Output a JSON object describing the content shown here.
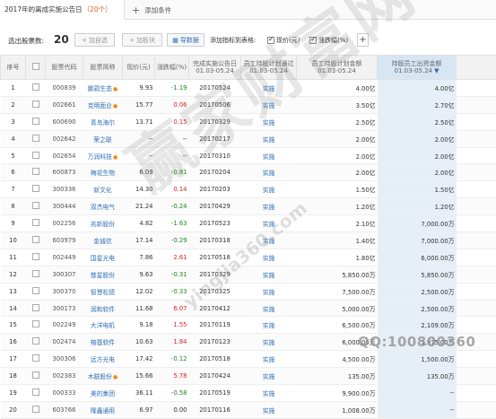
{
  "tab": {
    "title": "2017年的离成实施公告日",
    "count": "（20个）",
    "add_label": "添加条件"
  },
  "toolbar": {
    "selected_label": "选出股票数:",
    "selected_count": "20",
    "add_self_label": "加自选",
    "add_block_label": "加板块",
    "export_label": "导数据",
    "rank_label": "添加指标到表格:",
    "price_label": "现价(元)",
    "change_label": "涨跌幅(%)",
    "price_checked": true,
    "change_checked": true
  },
  "table": {
    "headers": [
      "序号",
      "",
      "股票代码",
      "股票简称",
      "现价(元)",
      "涨跌幅(%)",
      "完成实施公告日\n01.03-05.24",
      "员工持股计划通过\n01.03-05.24",
      "员工持股计划金额\n01.03-05.24",
      "持股员工出资金额\n01.03-05.24"
    ],
    "rows": [
      {
        "no": "1",
        "code": "000839",
        "name": "鹏鹞生态",
        "flame": true,
        "price": "9.93",
        "change": "-1.19",
        "date": "20170524",
        "status": "实施",
        "amount": "4.00亿",
        "fund": "4.00亿"
      },
      {
        "no": "2",
        "code": "002661",
        "name": "克明面业",
        "flame": true,
        "price": "15.77",
        "change": "0.06",
        "date": "20170506",
        "status": "实施",
        "amount": "3.50亿",
        "fund": "2.70亿"
      },
      {
        "no": "3",
        "code": "600690",
        "name": "青岛海尔",
        "flame": false,
        "price": "13.71",
        "change": "0.15",
        "date": "20170329",
        "status": "实施",
        "amount": "2.50亿",
        "fund": "2.50亿"
      },
      {
        "no": "4",
        "code": "002642",
        "name": "荣之联",
        "flame": false,
        "price": "--",
        "change": "--",
        "date": "20170217",
        "status": "实施",
        "amount": "2.00亿",
        "fund": "2.00亿"
      },
      {
        "no": "5",
        "code": "002654",
        "name": "万润科技",
        "flame": true,
        "price": "--",
        "change": "--",
        "date": "20170310",
        "status": "实施",
        "amount": "2.00亿",
        "fund": "2.00亿"
      },
      {
        "no": "6",
        "code": "600873",
        "name": "梅花生物",
        "flame": false,
        "price": "6.09",
        "change": "-0.81",
        "date": "20170204",
        "status": "实施",
        "amount": "2.00亿",
        "fund": "2.00亿"
      },
      {
        "no": "7",
        "code": "300336",
        "name": "新文化",
        "flame": false,
        "price": "14.30",
        "change": "0.14",
        "date": "20170203",
        "status": "实施",
        "amount": "1.50亿",
        "fund": "1.50亿"
      },
      {
        "no": "8",
        "code": "300444",
        "name": "双杰电气",
        "flame": false,
        "price": "21.24",
        "change": "-0.24",
        "date": "20170429",
        "status": "实施",
        "amount": "1.20亿",
        "fund": "1.20亿"
      },
      {
        "no": "9",
        "code": "002256",
        "name": "兆新股份",
        "flame": false,
        "price": "4.82",
        "change": "-1.63",
        "date": "20170523",
        "status": "实施",
        "amount": "2.10亿",
        "fund": "7,000.00万"
      },
      {
        "no": "10",
        "code": "603979",
        "name": "金诚信",
        "flame": false,
        "price": "17.14",
        "change": "-0.29",
        "date": "20170318",
        "status": "实施",
        "amount": "1.40亿",
        "fund": "7,000.00万"
      },
      {
        "no": "11",
        "code": "002449",
        "name": "国星光电",
        "flame": false,
        "price": "7.86",
        "change": "2.61",
        "date": "20170518",
        "status": "实施",
        "amount": "1.80亿",
        "fund": "6,000.00万"
      },
      {
        "no": "12",
        "code": "300307",
        "name": "慈星股份",
        "flame": false,
        "price": "9.63",
        "change": "-0.31",
        "date": "20170329",
        "status": "实施",
        "amount": "5,850.00万",
        "fund": "5,850.00万"
      },
      {
        "no": "13",
        "code": "300370",
        "name": "智慧松德",
        "flame": false,
        "price": "12.02",
        "change": "-0.33",
        "date": "20170325",
        "status": "实施",
        "amount": "7,500.00万",
        "fund": "2,500.00万"
      },
      {
        "no": "14",
        "code": "300173",
        "name": "润和软件",
        "flame": false,
        "price": "11.68",
        "change": "6.07",
        "date": "20170412",
        "status": "实施",
        "amount": "5,000.00万",
        "fund": "2,500.00万"
      },
      {
        "no": "15",
        "code": "002249",
        "name": "大洋电机",
        "flame": false,
        "price": "9.18",
        "change": "1.55",
        "date": "20170119",
        "status": "实施",
        "amount": "6,500.00万",
        "fund": "2,109.00万"
      },
      {
        "no": "16",
        "code": "002474",
        "name": "榕基软件",
        "flame": false,
        "price": "10.63",
        "change": "1.84",
        "date": "20170123",
        "status": "实施",
        "amount": "6,000.00万",
        "fund": "1,975.00万"
      },
      {
        "no": "17",
        "code": "300306",
        "name": "远方光电",
        "flame": false,
        "price": "17.42",
        "change": "-0.12",
        "date": "20170518",
        "status": "实施",
        "amount": "4,500.00万",
        "fund": "1,500.00万"
      },
      {
        "no": "18",
        "code": "002383",
        "name": "木联股份",
        "flame": true,
        "price": "15.66",
        "change": "5.78",
        "date": "20170424",
        "status": "实施",
        "amount": "135.00万",
        "fund": "135.00万"
      },
      {
        "no": "19",
        "code": "000333",
        "name": "美的集团",
        "flame": false,
        "price": "36.11",
        "change": "-0.58",
        "date": "20170519",
        "status": "实施",
        "amount": "9,900.00万",
        "fund": "--"
      },
      {
        "no": "20",
        "code": "603766",
        "name": "隆鑫通用",
        "flame": false,
        "price": "6.97",
        "change": "0.00",
        "date": "20170116",
        "status": "实施",
        "amount": "1,008.00万",
        "fund": "--"
      }
    ]
  },
  "watermark": {
    "main": "赢家财富网",
    "site": "yingjia360.com",
    "qq": "QQ:100800360"
  }
}
